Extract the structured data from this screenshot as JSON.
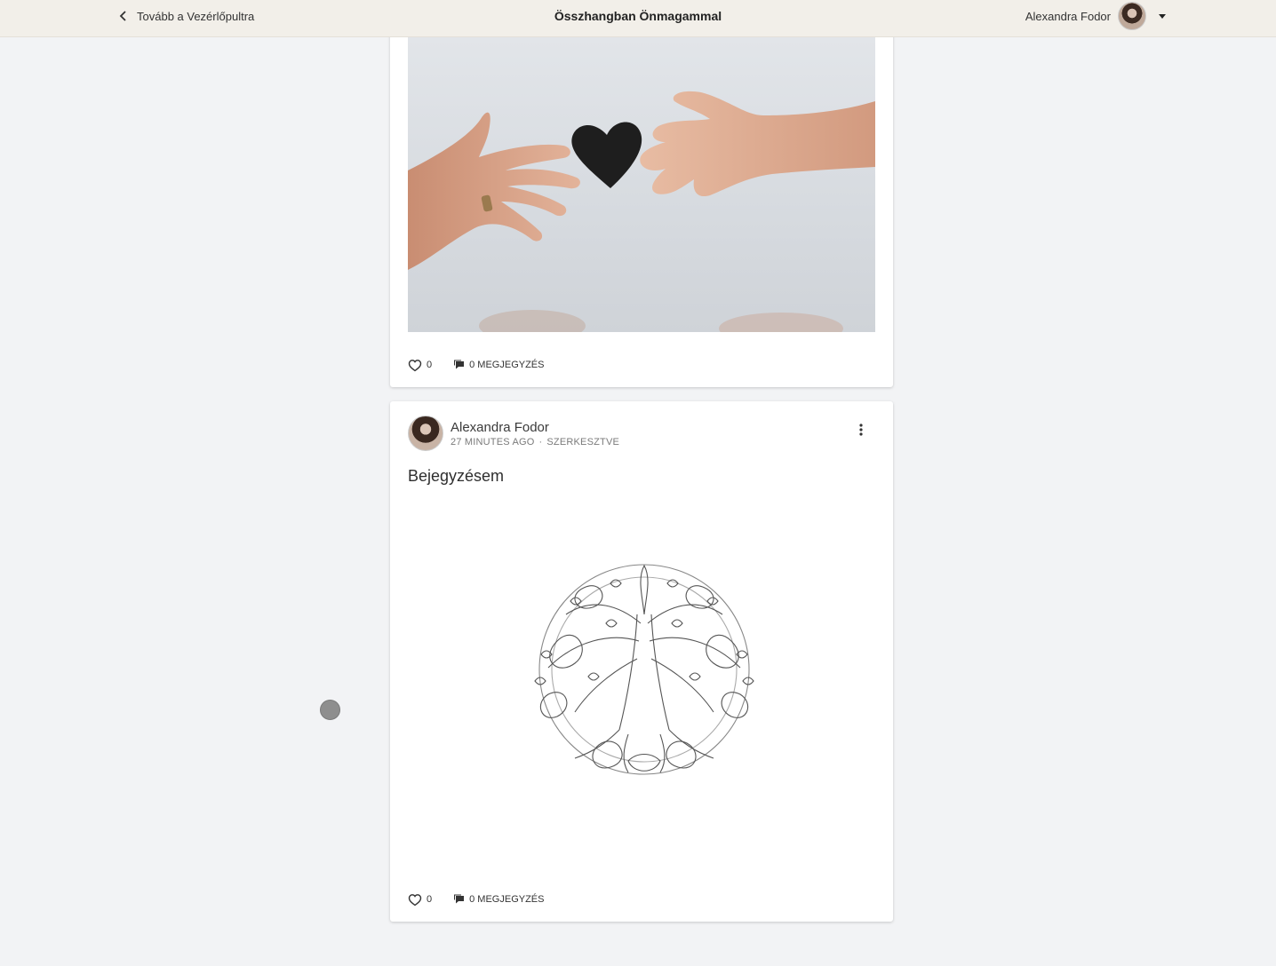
{
  "topbar": {
    "back_label": "Tovább a Vezérlőpultra",
    "site_title": "Összhangban Önmagammal",
    "user_name": "Alexandra Fodor"
  },
  "posts": [
    {
      "likes": "0",
      "comments": "0 MEGJEGYZÉS"
    },
    {
      "author": "Alexandra Fodor",
      "time": "27 MINUTES AGO",
      "edited": "SZERKESZTVE",
      "title": "Bejegyzésem",
      "likes": "0",
      "comments": "0 MEGJEGYZÉS"
    }
  ],
  "icons": {
    "back": "chevron-left-icon",
    "caret": "caret-down-icon",
    "like": "heart-icon",
    "comment": "comment-icon",
    "more": "more-vertical-icon"
  },
  "colors": {
    "topbar_bg": "#f2efe9",
    "page_bg": "#f2f3f5",
    "card_bg": "#ffffff"
  }
}
